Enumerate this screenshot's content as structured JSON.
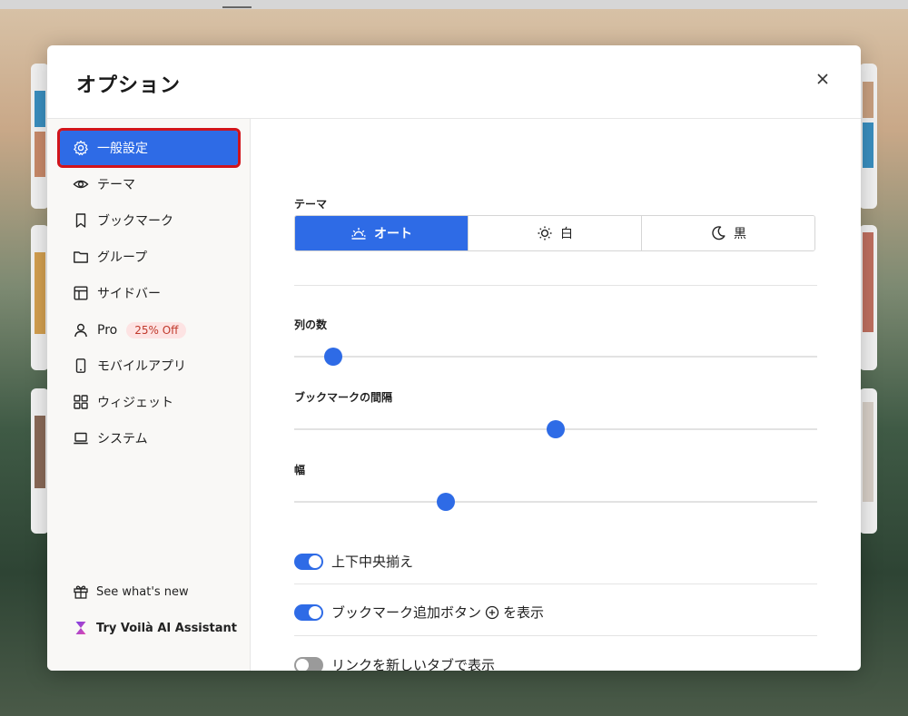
{
  "modal": {
    "title": "オプション"
  },
  "sidebar": {
    "items": [
      {
        "label": "一般設定",
        "icon": "gear-icon"
      },
      {
        "label": "テーマ",
        "icon": "eye-icon"
      },
      {
        "label": "ブックマーク",
        "icon": "bookmark-icon"
      },
      {
        "label": "グループ",
        "icon": "folder-icon"
      },
      {
        "label": "サイドバー",
        "icon": "layout-icon"
      },
      {
        "label": "Pro",
        "icon": "user-icon",
        "badge": "25% Off"
      },
      {
        "label": "モバイルアプリ",
        "icon": "phone-icon"
      },
      {
        "label": "ウィジェット",
        "icon": "grid-icon"
      },
      {
        "label": "システム",
        "icon": "laptop-icon"
      }
    ],
    "footer": [
      {
        "label": "See what's new",
        "icon": "gift-icon"
      },
      {
        "label": "Try Voilà AI Assistant",
        "icon": "hourglass-icon"
      }
    ]
  },
  "content": {
    "theme_label": "テーマ",
    "theme_options": [
      {
        "label": "オート",
        "icon": "sunrise-icon",
        "selected": true
      },
      {
        "label": "白",
        "icon": "sun-icon",
        "selected": false
      },
      {
        "label": "黒",
        "icon": "moon-icon",
        "selected": false
      }
    ],
    "sliders": [
      {
        "label": "列の数",
        "level": 0.075
      },
      {
        "label": "ブックマークの間隔",
        "level": 0.5
      },
      {
        "label": "幅",
        "level": 0.29
      }
    ],
    "toggles": [
      {
        "label": "上下中央揃え",
        "on": true
      },
      {
        "label_before": "ブックマーク追加ボタン",
        "label_after": "を表示",
        "on": true
      },
      {
        "label": "リンクを新しいタブで表示",
        "on": false
      }
    ]
  },
  "colors": {
    "accent": "#2e6be6",
    "highlight_outline": "#d1141b",
    "badge_bg": "#fde3e3",
    "badge_text": "#c0392b"
  }
}
